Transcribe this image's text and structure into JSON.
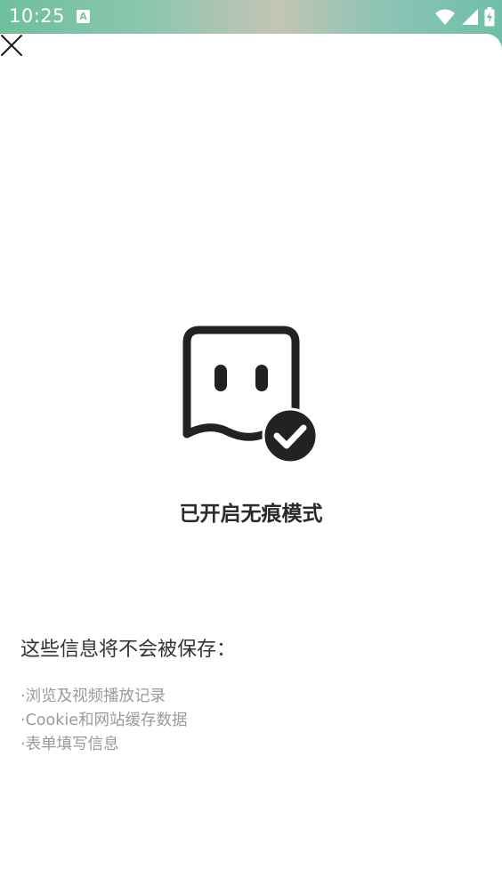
{
  "status_bar": {
    "time": "10:25",
    "app_icon_letter": "A"
  },
  "icons": {
    "close": "close-icon",
    "hero": "incognito-ghost-check-icon",
    "wifi": "wifi-icon",
    "signal": "signal-icon",
    "battery": "battery-charging-icon"
  },
  "hero": {
    "title": "已开启无痕模式"
  },
  "info": {
    "heading": "这些信息将不会被保存：",
    "items": [
      "·浏览及视频播放记录",
      "·Cookie和网站缓存数据",
      "·表单填写信息"
    ]
  },
  "colors": {
    "icon_dark": "#222222",
    "title": "#2a2a2a",
    "secondary_text": "#9a9a9a"
  }
}
